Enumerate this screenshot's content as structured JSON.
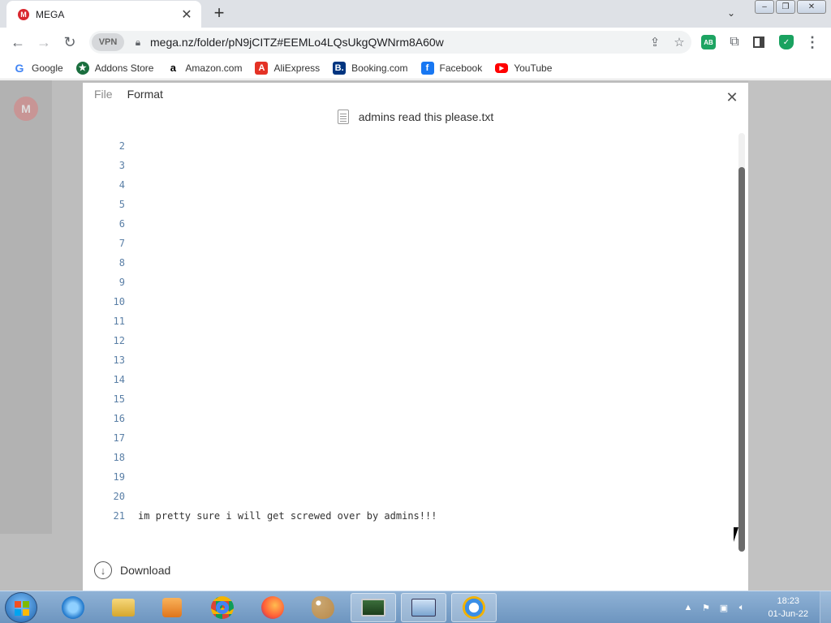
{
  "browser": {
    "tab": {
      "title": "MEGA",
      "favicon_letter": "M"
    },
    "address": {
      "vpn_label": "VPN",
      "url": "mega.nz/folder/pN9jCITZ#EEMLo4LQsUkgQWNrm8A60w"
    },
    "icons": {
      "back": "arrow-left-icon",
      "forward": "arrow-right-icon",
      "reload": "reload-icon",
      "share": "share-icon",
      "star": "star-icon"
    },
    "extension_labels": {
      "adblock": "AB"
    },
    "bookmarks": [
      {
        "label": "Google",
        "icon": "G"
      },
      {
        "label": "Addons Store",
        "icon": "★"
      },
      {
        "label": "Amazon.com",
        "icon": "a"
      },
      {
        "label": "AliExpress",
        "icon": "A"
      },
      {
        "label": "Booking.com",
        "icon": "B."
      },
      {
        "label": "Facebook",
        "icon": "f"
      },
      {
        "label": "YouTube",
        "icon": "▶"
      }
    ]
  },
  "viewer": {
    "menu": {
      "file": "File",
      "format": "Format"
    },
    "filename": "admins read this please.txt",
    "lines": [
      {
        "n": "2",
        "text": ""
      },
      {
        "n": "3",
        "text": ""
      },
      {
        "n": "4",
        "text": ""
      },
      {
        "n": "5",
        "text": ""
      },
      {
        "n": "6",
        "text": ""
      },
      {
        "n": "7",
        "text": ""
      },
      {
        "n": "8",
        "text": ""
      },
      {
        "n": "9",
        "text": ""
      },
      {
        "n": "10",
        "text": ""
      },
      {
        "n": "11",
        "text": ""
      },
      {
        "n": "12",
        "text": ""
      },
      {
        "n": "13",
        "text": ""
      },
      {
        "n": "14",
        "text": ""
      },
      {
        "n": "15",
        "text": ""
      },
      {
        "n": "16",
        "text": ""
      },
      {
        "n": "17",
        "text": ""
      },
      {
        "n": "18",
        "text": ""
      },
      {
        "n": "19",
        "text": ""
      },
      {
        "n": "20",
        "text": ""
      },
      {
        "n": "21",
        "text": "im pretty sure i will get screwed over by admins!!!"
      }
    ],
    "download_label": "Download"
  },
  "taskbar": {
    "clock_time": "18:23",
    "clock_date": "01-Jun-22"
  }
}
